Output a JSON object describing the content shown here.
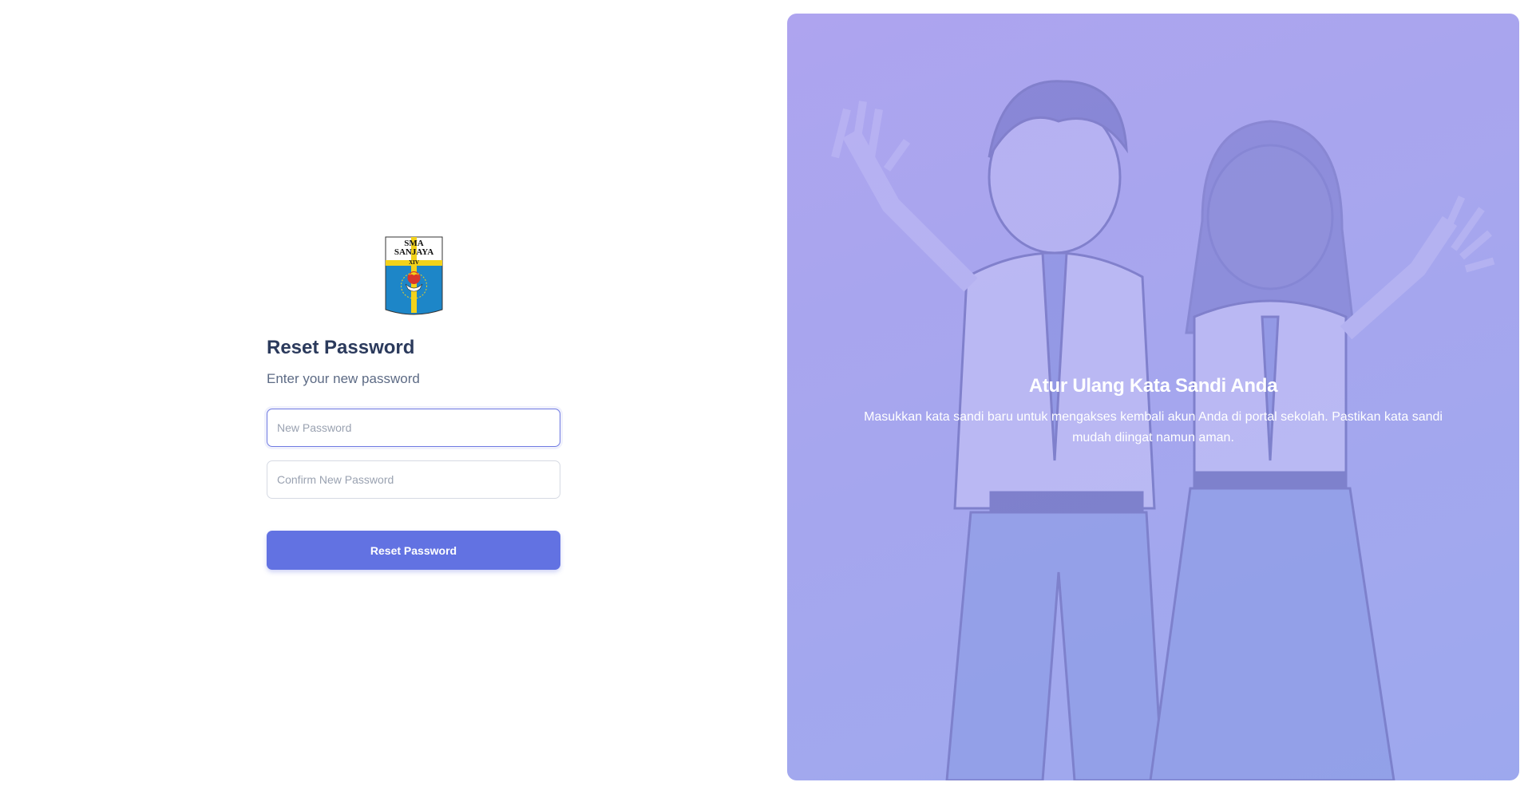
{
  "logo": {
    "line1": "SMA",
    "line2": "SANJAYA",
    "line3": "XIV",
    "colors": {
      "yellow": "#f3d21a",
      "blue": "#1d86c8",
      "red": "#d8362b"
    }
  },
  "form": {
    "title": "Reset Password",
    "subtitle": "Enter your new password",
    "new_password_placeholder": "New Password",
    "confirm_password_placeholder": "Confirm New Password",
    "submit_label": "Reset Password"
  },
  "hero": {
    "title": "Atur Ulang Kata Sandi Anda",
    "description": "Masukkan kata sandi baru untuk mengakses kembali akun Anda di portal sekolah. Pastikan kata sandi mudah diingat namun aman."
  },
  "colors": {
    "accent": "#6272e2",
    "heading": "#2b3a5c",
    "hero_bg": "#a6a6ee"
  }
}
